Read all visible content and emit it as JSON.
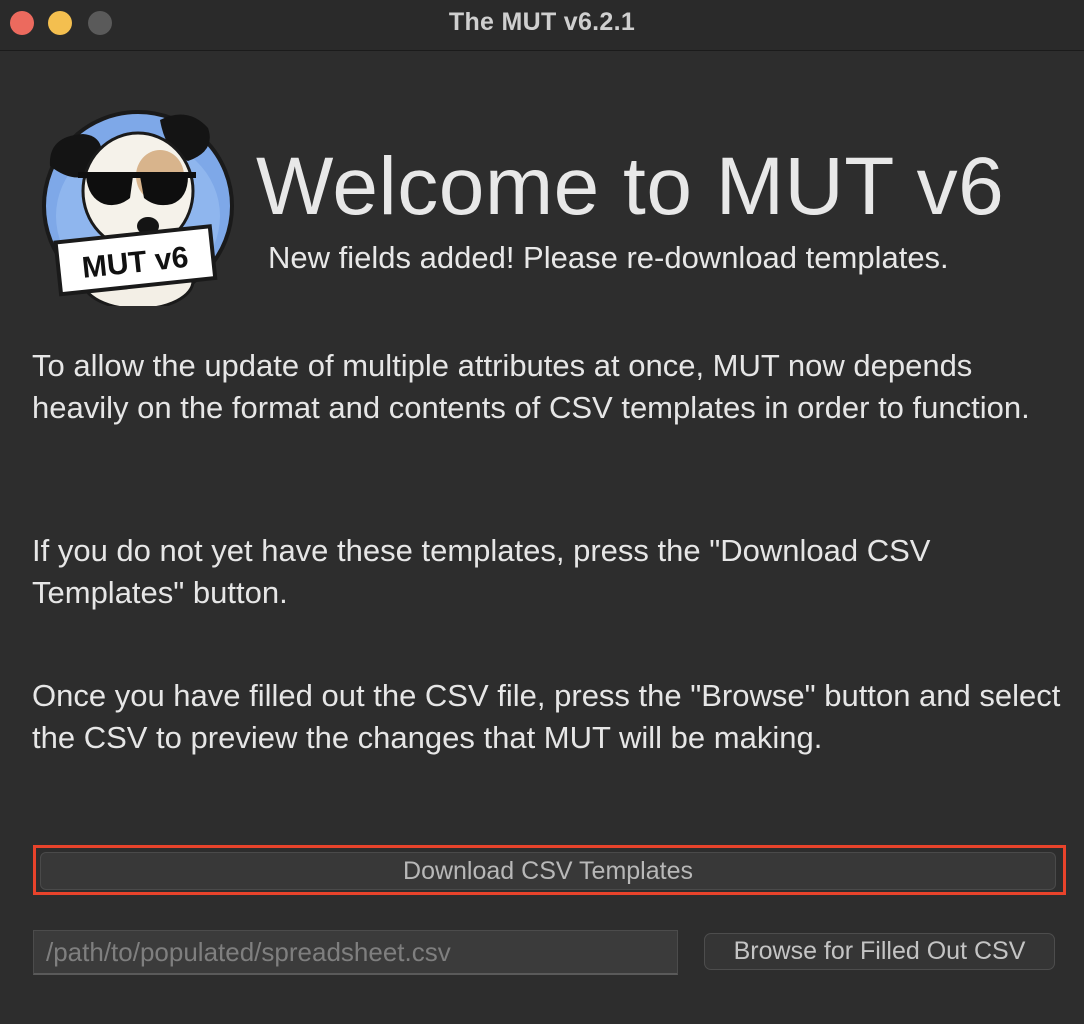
{
  "window": {
    "title": "The MUT v6.2.1"
  },
  "header": {
    "logo_text": "MUT v6",
    "heading": "Welcome to MUT v6",
    "subheading": "New fields added! Please re-download templates."
  },
  "body": {
    "paragraphs": [
      "To allow the update of multiple attributes at once, MUT now depends heavily on the format and contents of CSV templates in order to function.",
      "If you do not yet have these templates, press the \"Download CSV Templates\" button.",
      "Once you have filled out the CSV file, press the \"Browse\" button and select the CSV to preview the changes that MUT will be making."
    ]
  },
  "actions": {
    "download_label": "Download CSV Templates",
    "path_placeholder": "/path/to/populated/spreadsheet.csv",
    "browse_label": "Browse for Filled Out CSV"
  },
  "colors": {
    "highlight": "#e8432b",
    "background": "#2d2d2d",
    "text": "#e6e6e6"
  }
}
